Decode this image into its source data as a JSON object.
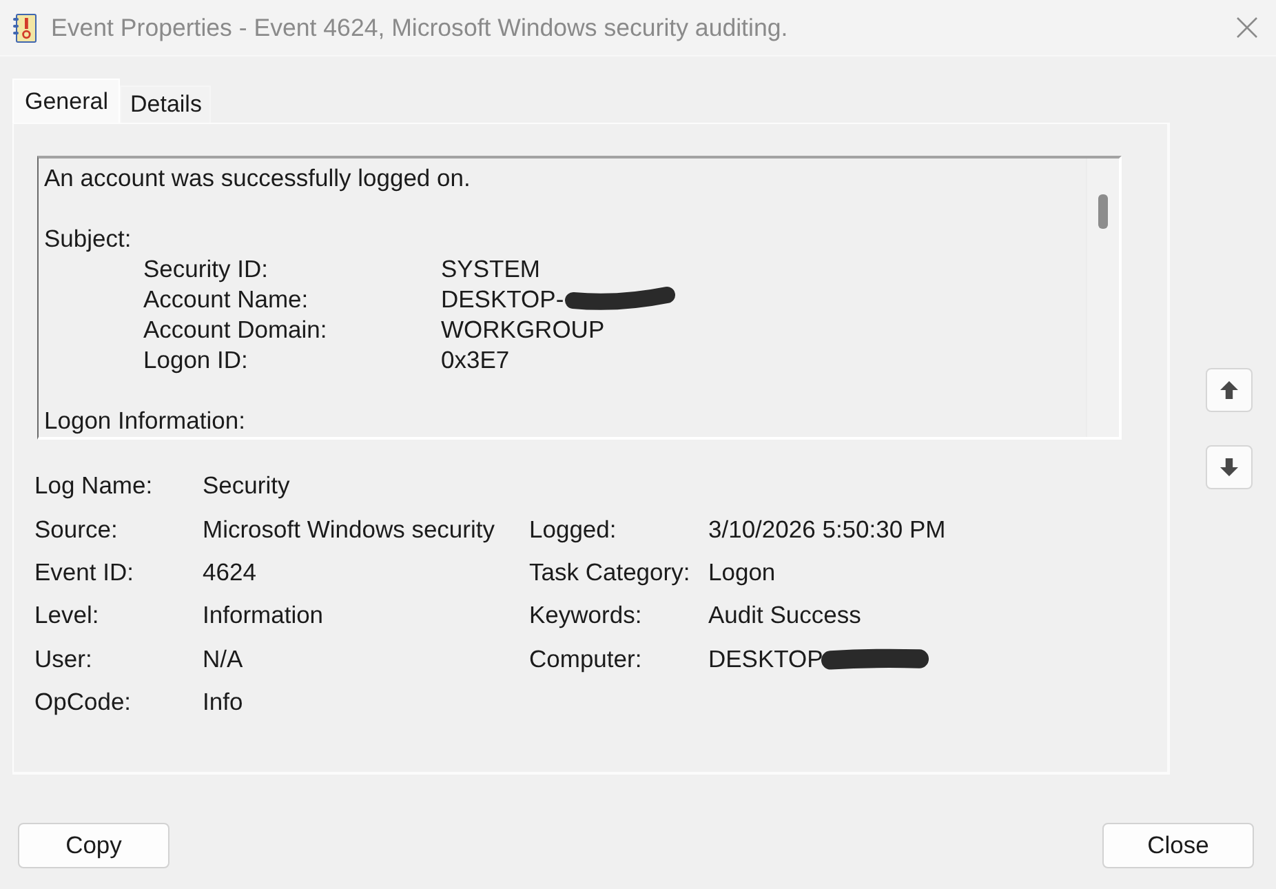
{
  "window": {
    "title": "Event Properties - Event 4624, Microsoft Windows security auditing."
  },
  "tabs": [
    {
      "label": "General",
      "selected": true
    },
    {
      "label": "Details",
      "selected": false
    }
  ],
  "description": {
    "intro": "An account was successfully logged on.",
    "sections": [
      {
        "title": "Subject:",
        "fields": [
          {
            "label": "Security ID:",
            "value": "SYSTEM",
            "redacted": false
          },
          {
            "label": "Account Name:",
            "value": "DESKTOP-",
            "redacted": true
          },
          {
            "label": "Account Domain:",
            "value": "WORKGROUP",
            "redacted": false
          },
          {
            "label": "Logon ID:",
            "value": "0x3E7",
            "redacted": false
          }
        ]
      },
      {
        "title": "Logon Information:"
      }
    ]
  },
  "properties": [
    {
      "fields": [
        {
          "label": "Log Name:",
          "value": "Security",
          "redacted": false
        }
      ]
    },
    {
      "fields": [
        {
          "label": "Source:",
          "value": "Microsoft Windows security",
          "redacted": false
        },
        {
          "label": "Logged:",
          "value": "3/10/2026 5:50:30 PM",
          "redacted": false
        }
      ]
    },
    {
      "fields": [
        {
          "label": "Event ID:",
          "value": "4624",
          "redacted": false
        },
        {
          "label": "Task Category:",
          "value": "Logon",
          "redacted": false
        }
      ]
    },
    {
      "fields": [
        {
          "label": "Level:",
          "value": "Information",
          "redacted": false
        },
        {
          "label": "Keywords:",
          "value": "Audit Success",
          "redacted": false
        }
      ]
    },
    {
      "fields": [
        {
          "label": "User:",
          "value": "N/A",
          "redacted": false
        },
        {
          "label": "Computer:",
          "value": "DESKTOP",
          "redacted": true
        }
      ]
    },
    {
      "fields": [
        {
          "label": "OpCode:",
          "value": "Info",
          "redacted": false
        }
      ]
    }
  ],
  "buttons": [
    "Copy",
    "Close"
  ]
}
